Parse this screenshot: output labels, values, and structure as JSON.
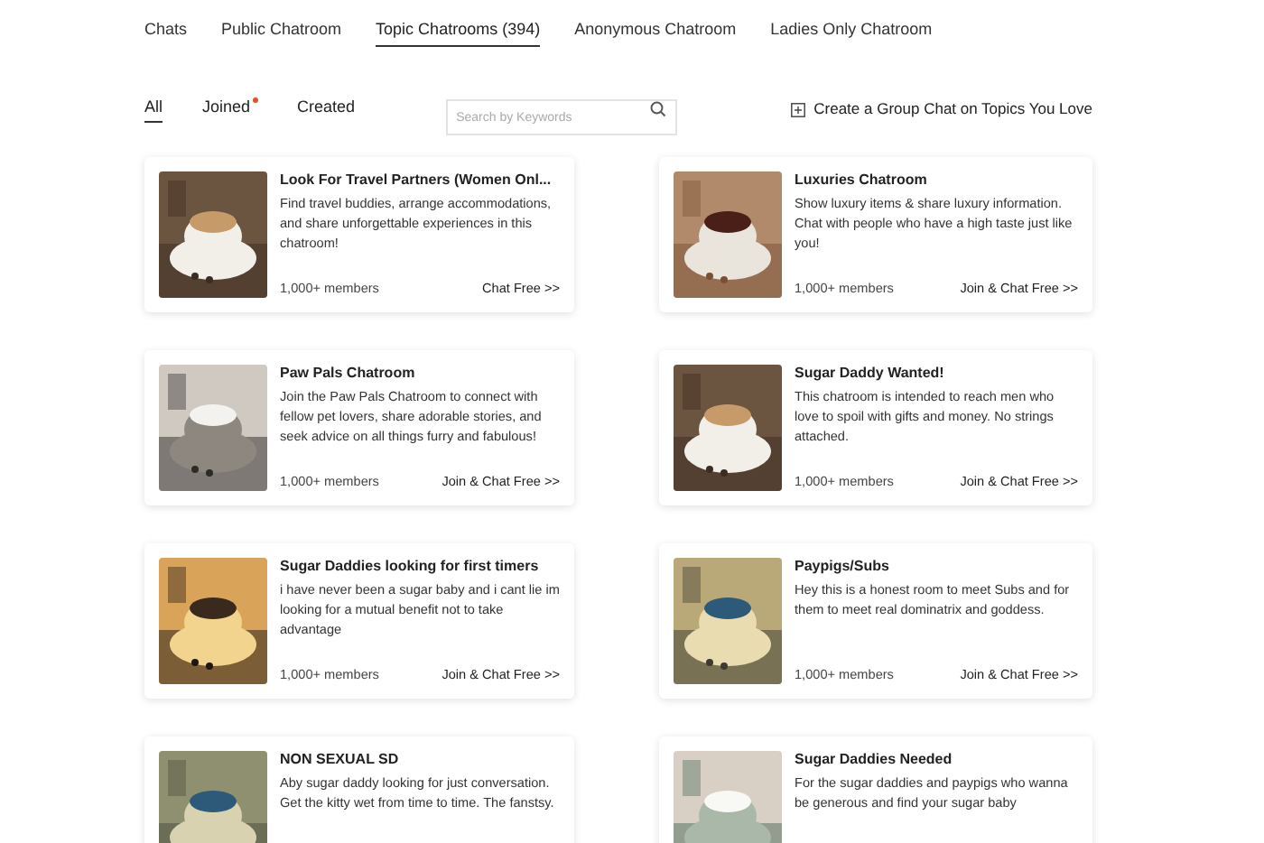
{
  "tabs": [
    {
      "label": "Chats",
      "selected": false
    },
    {
      "label": "Public Chatroom",
      "selected": false
    },
    {
      "label": "Topic Chatrooms (394)",
      "selected": true
    },
    {
      "label": "Anonymous Chatroom",
      "selected": false
    },
    {
      "label": "Ladies Only Chatroom",
      "selected": false
    }
  ],
  "filters": [
    {
      "label": "All",
      "selected": true,
      "dot": false
    },
    {
      "label": "Joined",
      "selected": false,
      "dot": true
    },
    {
      "label": "Created",
      "selected": false,
      "dot": false
    }
  ],
  "search": {
    "placeholder": "Search by Keywords"
  },
  "create_button": "Create a Group Chat on Topics You Love",
  "rooms": [
    {
      "title": "Look For Travel Partners (Women Onl...",
      "description": "Find travel buddies, arrange accommodations, and share unforgettable experiences in this chatroom!",
      "members": "1,000+ members",
      "action": "Chat Free >>"
    },
    {
      "title": "Luxuries Chatroom",
      "description": "Show luxury items & share luxury information. Chat with people who have a high taste just like you!",
      "members": "1,000+ members",
      "action": "Join & Chat Free >>"
    },
    {
      "title": "Paw Pals Chatroom",
      "description": "Join the Paw Pals Chatroom to connect with fellow pet lovers, share adorable stories, and seek advice on all things furry and fabulous!",
      "members": "1,000+ members",
      "action": "Join & Chat Free >>"
    },
    {
      "title": "Sugar Daddy Wanted!",
      "description": "This chatroom is intended to reach men who love to spoil with gifts and money. No strings attached.",
      "members": "1,000+ members",
      "action": "Join & Chat Free >>"
    },
    {
      "title": "Sugar Daddies looking for first timers",
      "description": "i have never been a sugar baby and i cant lie im looking for a mutual benefit not to take advantage",
      "members": "1,000+ members",
      "action": "Join & Chat Free >>"
    },
    {
      "title": "Paypigs/Subs",
      "description": "Hey this is a honest room to meet Subs and for them to meet real dominatrix and goddess.",
      "members": "1,000+ members",
      "action": "Join & Chat Free >>"
    },
    {
      "title": "NON SEXUAL SD",
      "description": "Aby sugar daddy looking for just conversation. Get the kitty wet from time to time. The fanstsy."
    },
    {
      "title": "Sugar Daddies Needed",
      "description": "For the sugar daddies and paypigs who wanna be generous and find your sugar baby"
    }
  ]
}
